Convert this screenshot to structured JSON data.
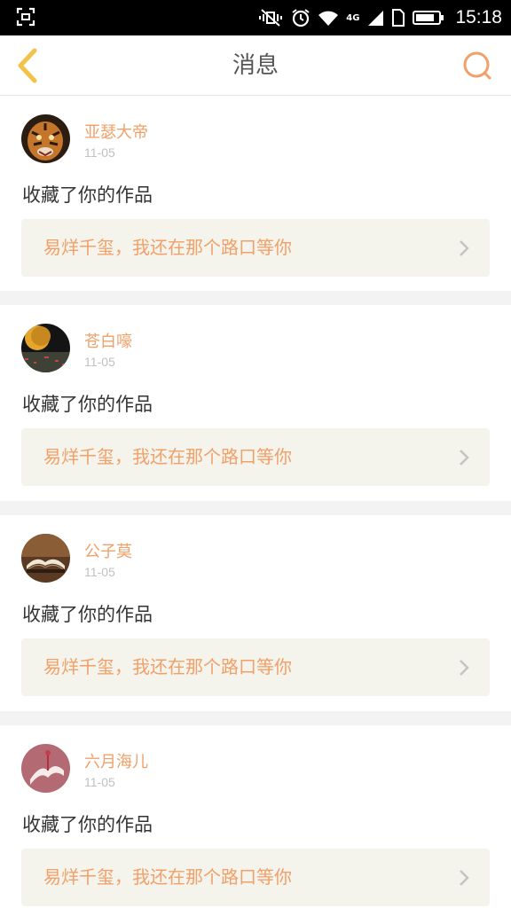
{
  "status_bar": {
    "time": "15:18",
    "network": "4G",
    "icons": [
      "screenshot-icon",
      "vibrate-icon",
      "alarm-icon",
      "wifi-icon",
      "signal-icon",
      "sim-icon",
      "battery-icon"
    ]
  },
  "header": {
    "title": "消息",
    "back_icon": "chevron-left-icon",
    "search_icon": "search-icon",
    "accent_color": "#f0a068",
    "back_color": "#f2c24a"
  },
  "messages": [
    {
      "username": "亚瑟大帝",
      "date": "11-05",
      "action": "收藏了你的作品",
      "work_title": "易烊千玺，我还在那个路口等你",
      "avatar": "tiger-avatar"
    },
    {
      "username": "苍白嚎",
      "date": "11-05",
      "action": "收藏了你的作品",
      "work_title": "易烊千玺，我还在那个路口等你",
      "avatar": "moon-field-avatar"
    },
    {
      "username": "公子莫",
      "date": "11-05",
      "action": "收藏了你的作品",
      "work_title": "易烊千玺，我还在那个路口等你",
      "avatar": "book-avatar"
    },
    {
      "username": "六月海儿",
      "date": "11-05",
      "action": "收藏了你的作品",
      "work_title": "易烊千玺，我还在那个路口等你",
      "avatar": "pink-book-avatar"
    }
  ]
}
